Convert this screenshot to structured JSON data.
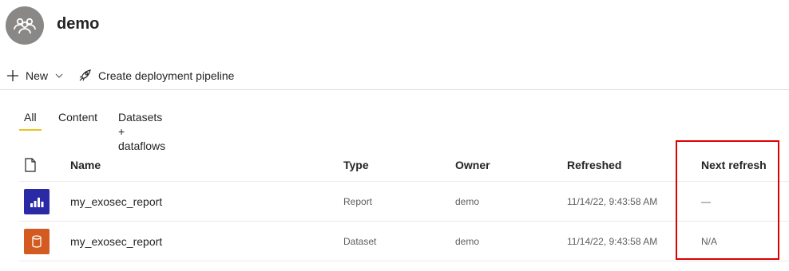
{
  "workspace": {
    "title": "demo"
  },
  "toolbar": {
    "new_label": "New",
    "pipeline_label": "Create deployment pipeline"
  },
  "tabs": [
    {
      "label": "All",
      "active": true
    },
    {
      "label": "Content",
      "active": false
    },
    {
      "label": "Datasets + dataflows",
      "active": false
    }
  ],
  "table": {
    "columns": {
      "name": "Name",
      "type": "Type",
      "owner": "Owner",
      "refreshed": "Refreshed",
      "next_refresh": "Next refresh"
    },
    "rows": [
      {
        "icon": "report-icon",
        "icon_color": "#2b2aa6",
        "name": "my_exosec_report",
        "type": "Report",
        "owner": "demo",
        "refreshed": "11/14/22, 9:43:58 AM",
        "next_refresh": "—"
      },
      {
        "icon": "dataset-icon",
        "icon_color": "#d35a20",
        "name": "my_exosec_report",
        "type": "Dataset",
        "owner": "demo",
        "refreshed": "11/14/22, 9:43:58 AM",
        "next_refresh": "N/A"
      }
    ]
  },
  "colors": {
    "tab_indicator": "#e8c41f",
    "highlight_box": "#e00000",
    "avatar_bg": "#8a8886"
  }
}
